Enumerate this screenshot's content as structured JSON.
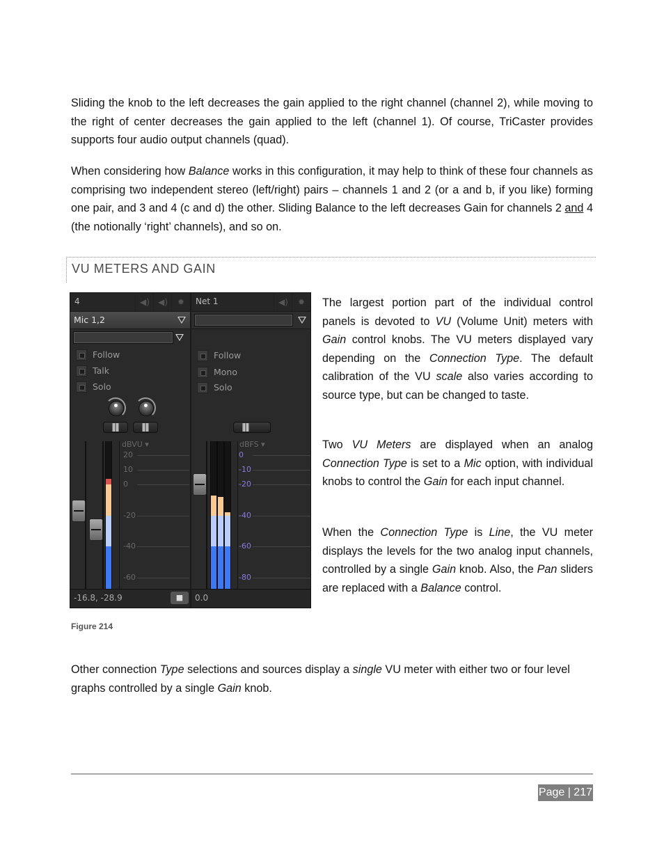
{
  "paragraphs": {
    "p1": "Sliding the knob to the left decreases the gain applied to the right channel (channel 2), while moving to the right of center decreases the gain applied to the left (channel 1). Of course, TriCaster provides supports four audio output channels (quad).",
    "p2_a": "When considering how ",
    "p2_b": "Balance",
    "p2_c": " works in this configuration, it may help to think of these four channels as comprising two independent stereo (left/right) pairs – channels 1 and 2 (or a and b, if you like) forming one pair, and 3 and 4 (c and d) the other.  Sliding Balance to the left decreases Gain for channels 2 ",
    "p2_d": "and",
    "p2_e": " 4 (the notionally ‘right’ channels), and so on."
  },
  "section": {
    "heading": "VU METERS AND GAIN"
  },
  "side_text": {
    "s1": [
      "The largest portion part of the individual control panels is devoted to ",
      "VU",
      " (Volume Unit) meters with ",
      "Gain",
      " control knobs.  The VU meters displayed vary depending on the ",
      "Connection Type",
      ". The default calibration of the VU ",
      "scale",
      " also varies according to source type, but can be changed to taste."
    ],
    "s2": [
      "Two ",
      "VU Meters",
      " are displayed when an analog ",
      "Connection Type",
      " is set to a ",
      "Mic",
      " option, with individual knobs to control the ",
      "Gain",
      " for each input channel."
    ],
    "s3": [
      "When the ",
      "Connection Type",
      " is ",
      "Line",
      ", the VU meter displays the levels for the two analog input channels, controlled by a single ",
      "Gain",
      " knob.  Also, the ",
      "Pan",
      " sliders are replaced with a ",
      "Balance",
      " control."
    ]
  },
  "figure": {
    "caption": "Figure 214",
    "left_channel": {
      "title": "4",
      "source": "Mic 1,2",
      "options": [
        "Follow",
        "Talk",
        "Solo"
      ],
      "scale_label": "dBVU",
      "ticks": [
        "20",
        "10",
        "0",
        "-20",
        "-40",
        "-60"
      ],
      "readout": "-16.8, -28.9",
      "meter_levels_db": [
        4
      ],
      "colors": {
        "red": "#d9534f",
        "orange": "#f9c994",
        "light_blue": "#b9cdfa",
        "blue": "#3d78f5"
      }
    },
    "right_channel": {
      "title": "Net 1",
      "source": "",
      "options": [
        "Follow",
        "Mono",
        "Solo"
      ],
      "scale_label": "dBFS",
      "ticks": [
        "0",
        "-10",
        "-20",
        "-40",
        "-60",
        "-80"
      ],
      "readout": "0.0",
      "meter_levels_db": [
        -27,
        -28,
        -38
      ],
      "tick_color": "#8a7cdc"
    },
    "icons": [
      "speaker-icon",
      "gear-icon",
      "lock-icon",
      "dropdown-arrow-icon"
    ]
  },
  "closing": [
    "Other connection ",
    "Type",
    " selections and sources display a ",
    "single",
    " VU meter with either two or four level graphs controlled by a single ",
    "Gain",
    " knob."
  ],
  "footer": {
    "page": "Page | 217"
  }
}
